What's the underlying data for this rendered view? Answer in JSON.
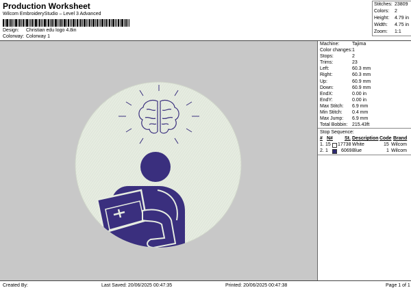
{
  "header": {
    "title": "Production Worksheet",
    "subtitle": "Wilcom EmbroideryStudio – Level 3 Advanced",
    "design_label": "Design:",
    "design_value": "Christian edu logo 4.8in",
    "colorway_label": "Colorway:",
    "colorway_value": "Colorway 1"
  },
  "summary": [
    {
      "label": "Stitches:",
      "value": "23809"
    },
    {
      "label": "Colors:",
      "value": "2"
    },
    {
      "label": "Height:",
      "value": "4.79 in"
    },
    {
      "label": "Width:",
      "value": "4.75 in"
    },
    {
      "label": "Zoom:",
      "value": "1:1"
    }
  ],
  "details": [
    {
      "label": "Machine:",
      "value": "Tajima"
    },
    {
      "label": "Color changes:",
      "value": "1"
    },
    {
      "label": "Stops:",
      "value": "2"
    },
    {
      "label": "Trims:",
      "value": "23"
    },
    {
      "label": "Left:",
      "value": "60.3 mm"
    },
    {
      "label": "Right:",
      "value": "60.3 mm"
    },
    {
      "label": "Up:",
      "value": "60.9 mm"
    },
    {
      "label": "Down:",
      "value": "60.9 mm"
    },
    {
      "label": "EndX:",
      "value": "0.00 in"
    },
    {
      "label": "EndY:",
      "value": "0.00 in"
    },
    {
      "label": "Max Stitch:",
      "value": "6.9 mm"
    },
    {
      "label": "Min Stitch:",
      "value": "0.4 mm"
    },
    {
      "label": "Max Jump:",
      "value": "6.9 mm"
    },
    {
      "label": "Total Bobbin:",
      "value": "215.43ft"
    }
  ],
  "stop_sequence": {
    "title": "Stop Sequence:",
    "headers": {
      "num": "#",
      "n": "N#",
      "st": "St.",
      "desc": "Description",
      "code": "Code",
      "brand": "Brand"
    },
    "rows": [
      {
        "num": "1.",
        "n": "15",
        "st": "17738",
        "desc": "White",
        "code": "15",
        "brand": "Wilcom",
        "color": "#ffffff"
      },
      {
        "num": "2.",
        "n": "1",
        "st": "6069",
        "desc": "Blue",
        "code": "1",
        "brand": "Wilcom",
        "color": "#2e2a72"
      }
    ]
  },
  "footer": {
    "created": "Created By:",
    "saved": "Last Saved: 20/06/2025 00:47:35",
    "printed": "Printed: 20/06/2025 00:47:38",
    "page": "Page 1 of 1"
  },
  "colors": {
    "canvas_bg": "#c8c8c8",
    "fabric": "#e6ece1",
    "thread_blue": "#3a2f7e"
  }
}
